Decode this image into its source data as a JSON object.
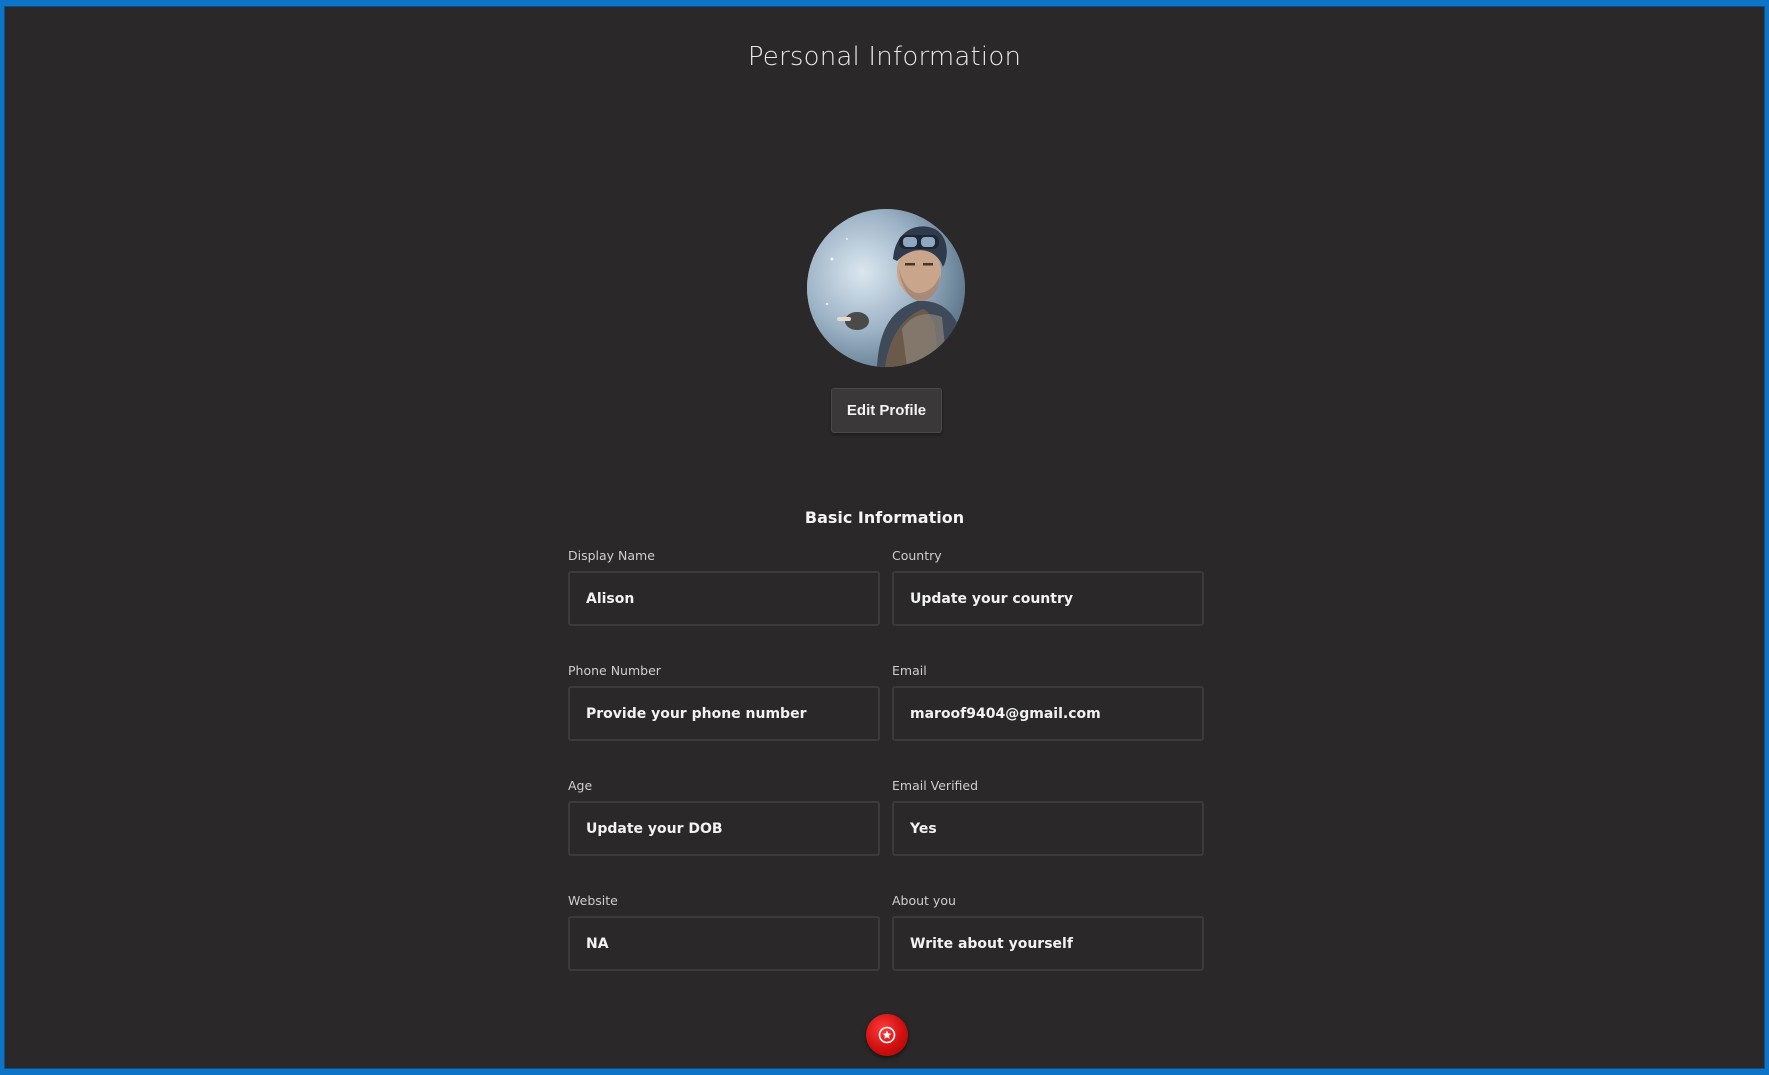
{
  "header": {
    "title": "Personal Information"
  },
  "profile": {
    "avatar_icon": "profile-photo",
    "edit_label": "Edit Profile"
  },
  "basic_info": {
    "title": "Basic Information",
    "fields": [
      {
        "label": "Display Name",
        "value": "Alison"
      },
      {
        "label": "Country",
        "value": "Update your country"
      },
      {
        "label": "Phone Number",
        "value": "Provide your phone number"
      },
      {
        "label": "Email",
        "value": "maroof9404@gmail.com"
      },
      {
        "label": "Age",
        "value": "Update your DOB"
      },
      {
        "label": "Email Verified",
        "value": "Yes"
      },
      {
        "label": "Website",
        "value": "NA"
      },
      {
        "label": "About you",
        "value": "Write about yourself"
      }
    ]
  },
  "fab": {
    "icon": "badge-icon",
    "color": "#d10f0f"
  },
  "colors": {
    "background": "#2a2829",
    "frame_border": "#0d74c8",
    "field_border": "#3c3a3b"
  }
}
